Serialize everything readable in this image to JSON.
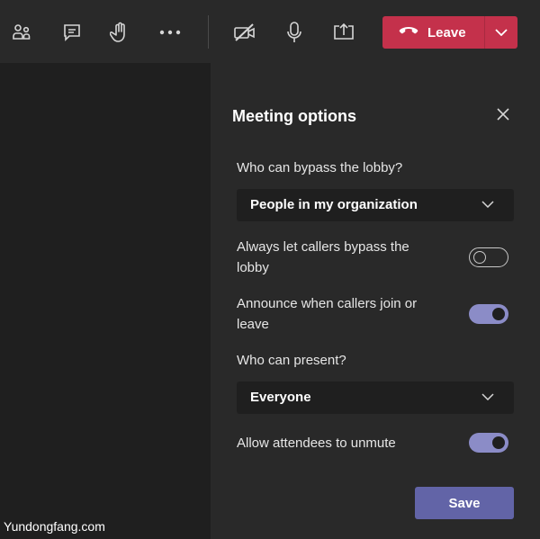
{
  "toolbar": {
    "icons": [
      "participants-icon",
      "chat-icon",
      "raise-hand-icon",
      "more-options-icon",
      "camera-off-icon",
      "microphone-icon",
      "share-screen-icon"
    ],
    "leave_label": "Leave",
    "leave_color": "#c4314b"
  },
  "meeting_options": {
    "title": "Meeting options",
    "bypass_lobby_label": "Who can bypass the lobby?",
    "bypass_lobby_value": "People in my organization",
    "callers_bypass_label_1": "Always let callers bypass the",
    "callers_bypass_label_2": "lobby",
    "callers_bypass_on": false,
    "announce_label_1": "Announce when callers join or",
    "announce_label_2": "leave",
    "announce_on": true,
    "who_present_label": "Who can present?",
    "who_present_value": "Everyone",
    "unmute_label": "Allow attendees to unmute",
    "unmute_on": true,
    "save_label": "Save",
    "accent_color": "#6264a7"
  },
  "watermark": "Yundongfang.com"
}
